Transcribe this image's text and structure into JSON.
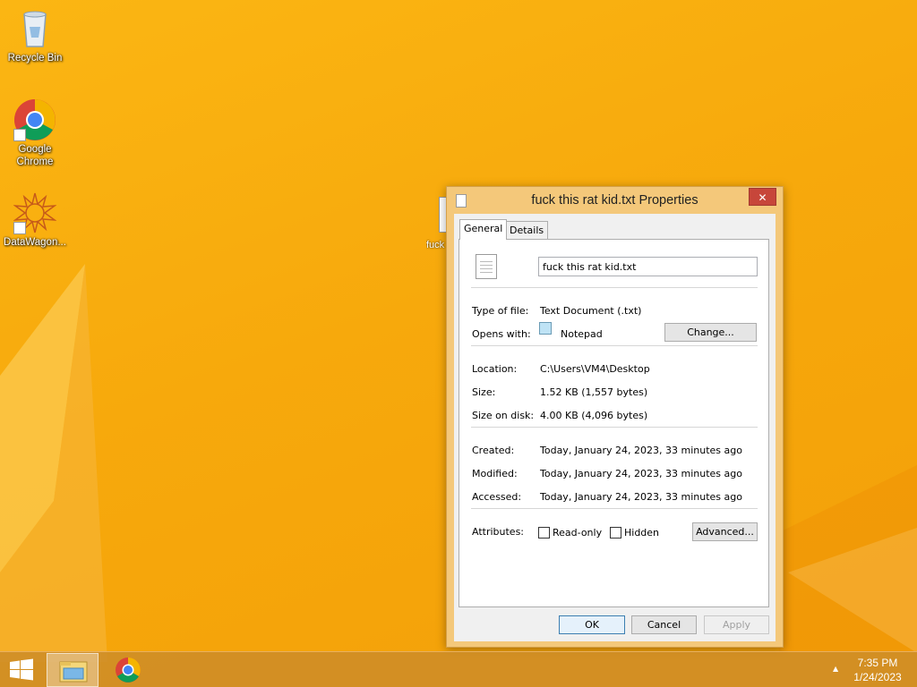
{
  "desktop": {
    "icons": [
      {
        "label": "Recycle Bin",
        "icon": "recycle-bin-icon"
      },
      {
        "label": "Google Chrome",
        "icon": "chrome-icon"
      },
      {
        "label": "DataWagon...",
        "icon": "datawagon-icon"
      }
    ],
    "behind_file_label": "fuck K"
  },
  "dialog": {
    "title": "fuck this rat kid.txt Properties",
    "close_label": "✕",
    "tabs": [
      {
        "label": "General"
      },
      {
        "label": "Details"
      }
    ],
    "filename": "fuck this rat kid.txt",
    "type_label": "Type of file:",
    "type_value": "Text Document (.txt)",
    "opens_label": "Opens with:",
    "opens_value": "Notepad",
    "change_button": "Change...",
    "location_label": "Location:",
    "location_value": "C:\\Users\\VM4\\Desktop",
    "size_label": "Size:",
    "size_value": "1.52 KB (1,557 bytes)",
    "size_disk_label": "Size on disk:",
    "size_disk_value": "4.00 KB (4,096 bytes)",
    "created_label": "Created:",
    "created_value": "Today, January 24, 2023, 33 minutes ago",
    "modified_label": "Modified:",
    "modified_value": "Today, January 24, 2023, 33 minutes ago",
    "accessed_label": "Accessed:",
    "accessed_value": "Today, January 24, 2023, 33 minutes ago",
    "attributes_label": "Attributes:",
    "readonly_label": "Read-only",
    "hidden_label": "Hidden",
    "advanced_button": "Advanced...",
    "ok_button": "OK",
    "cancel_button": "Cancel",
    "apply_button": "Apply"
  },
  "taskbar": {
    "time": "7:35 PM",
    "date": "1/24/2023",
    "tray_arrow": "▲"
  },
  "colors": {
    "wallpaper": "#f7a90c",
    "dialog_frame": "#f4c87a",
    "close_button": "#c7463a"
  }
}
